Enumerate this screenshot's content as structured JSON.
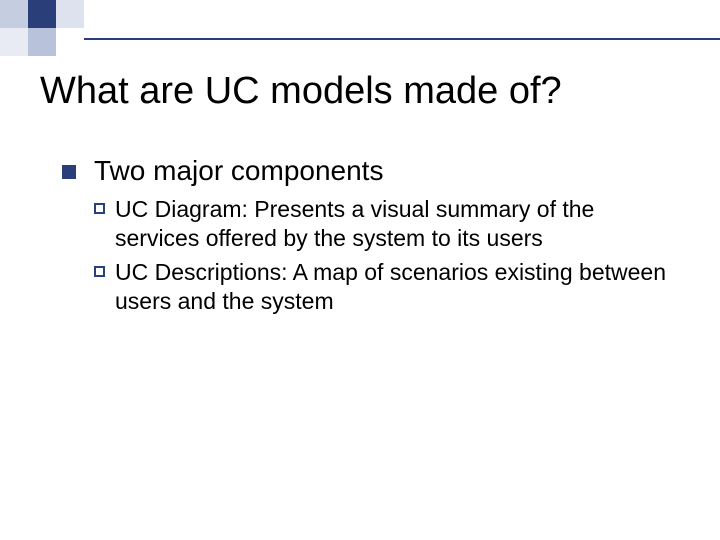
{
  "title": "What are UC models made of?",
  "content": {
    "heading": "Two major components",
    "items": [
      "UC Diagram: Presents a visual summary of the services offered by the system to its users",
      "UC Descriptions: A map of scenarios existing between users and the system"
    ]
  }
}
